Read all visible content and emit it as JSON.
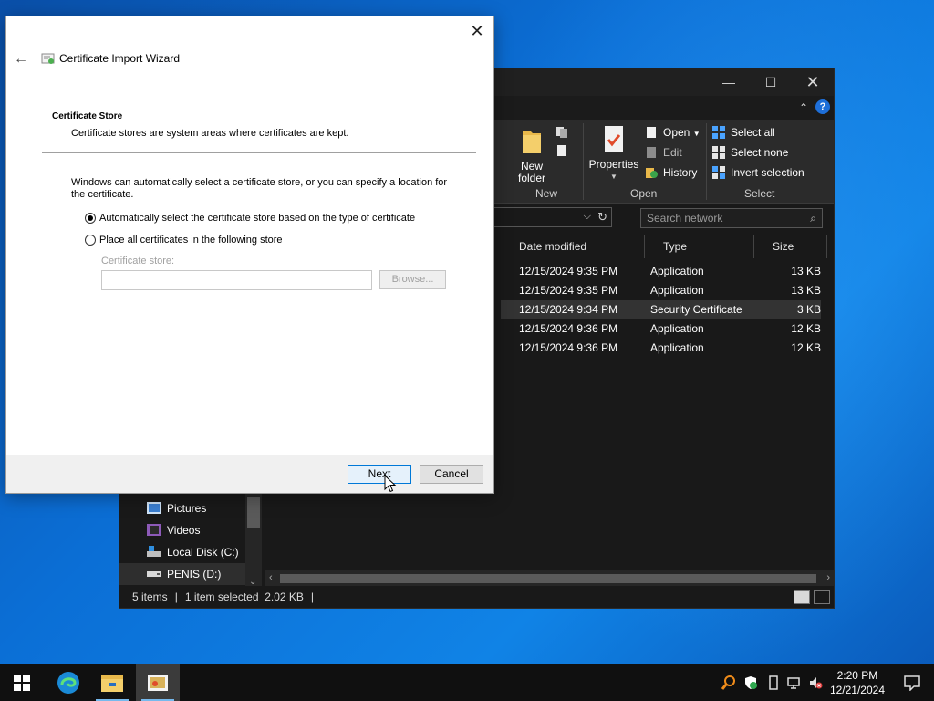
{
  "explorer": {
    "ribbon": {
      "new_folder": "New\nfolder",
      "properties": "Properties",
      "open": "Open",
      "edit": "Edit",
      "history": "History",
      "select_all": "Select all",
      "select_none": "Select none",
      "invert_selection": "Invert selection",
      "group_new": "New",
      "group_open": "Open",
      "group_select": "Select"
    },
    "search_placeholder": "Search network",
    "columns": {
      "date": "Date modified",
      "type": "Type",
      "size": "Size"
    },
    "files": [
      {
        "date": "12/15/2024 9:35 PM",
        "type": "Application",
        "size": "13 KB"
      },
      {
        "date": "12/15/2024 9:35 PM",
        "type": "Application",
        "size": "13 KB"
      },
      {
        "date": "12/15/2024 9:34 PM",
        "type": "Security Certificate",
        "size": "3 KB"
      },
      {
        "date": "12/15/2024 9:36 PM",
        "type": "Application",
        "size": "12 KB"
      },
      {
        "date": "12/15/2024 9:36 PM",
        "type": "Application",
        "size": "12 KB"
      }
    ],
    "nav": [
      {
        "label": "Pictures",
        "icon": "pictures-icon"
      },
      {
        "label": "Videos",
        "icon": "videos-icon"
      },
      {
        "label": "Local Disk (C:)",
        "icon": "local-disk-icon"
      },
      {
        "label": "PENIS (D:)",
        "icon": "drive-icon"
      }
    ],
    "status": {
      "items": "5 items",
      "selected": "1 item selected  2.02 KB"
    }
  },
  "wizard": {
    "title": "Certificate Import Wizard",
    "section_title": "Certificate Store",
    "section_desc": "Certificate stores are system areas where certificates are kept.",
    "intro": "Windows can automatically select a certificate store, or you can specify a location for the certificate.",
    "radio_auto": "Automatically select the certificate store based on the type of certificate",
    "radio_manual": "Place all certificates in the following store",
    "store_label": "Certificate store:",
    "store_value": "",
    "browse": "Browse...",
    "next": "Next",
    "cancel": "Cancel",
    "selected_option": "auto"
  },
  "taskbar": {
    "time": "2:20 PM",
    "date": "12/21/2024"
  },
  "colors": {
    "accent": "#0078d7",
    "explorer_bg": "#191919",
    "desktop": "#0b6fd6"
  }
}
